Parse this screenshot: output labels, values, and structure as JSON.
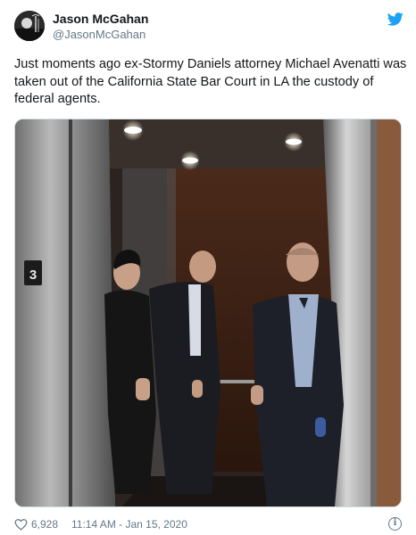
{
  "user": {
    "name": "Jason McGahan",
    "handle": "@JasonMcGahan"
  },
  "tweet": {
    "text": "Just moments ago ex-Stormy Daniels attorney Michael Avenatti was taken out of the California State Bar Court in LA the custody of federal agents."
  },
  "photo": {
    "floor_label": "3",
    "alt": "Photo inside an elevator with three men"
  },
  "footer": {
    "like_count": "6,928",
    "timestamp": "11:14 AM - Jan 15, 2020",
    "info_icon": "i"
  },
  "icons": {
    "avatar": "avatar-icon",
    "brand": "twitter-bird-icon",
    "like": "heart-icon",
    "info": "info-icon"
  },
  "colors": {
    "brand": "#1da1f2",
    "text": "#14171a",
    "secondary": "#657786"
  }
}
